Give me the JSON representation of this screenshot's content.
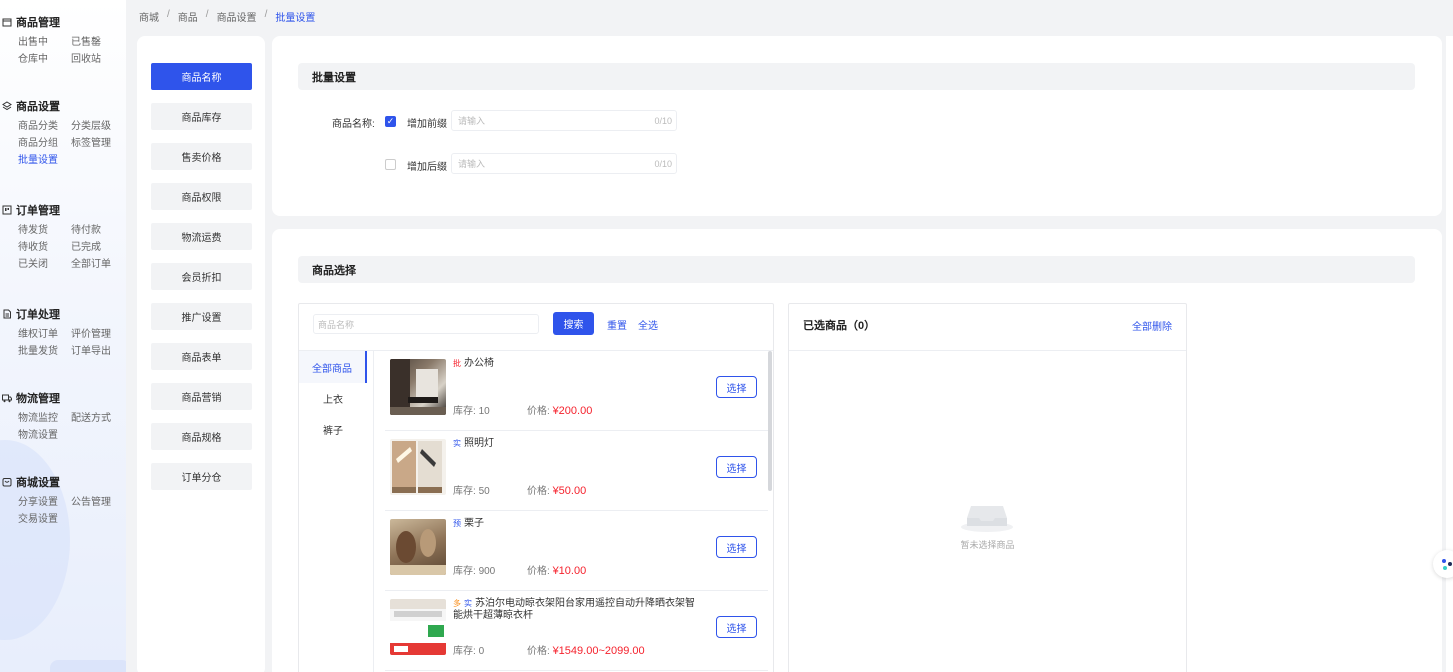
{
  "sidebar": {
    "groups": [
      {
        "title": "商品管理",
        "icon": "box-icon",
        "items": [
          "出售中",
          "已售罄",
          "仓库中",
          "回收站"
        ]
      },
      {
        "title": "商品设置",
        "icon": "layers-icon",
        "items": [
          "商品分类",
          "分类层级",
          "商品分组",
          "标签管理",
          "批量设置"
        ]
      },
      {
        "title": "订单管理",
        "icon": "order-icon",
        "items": [
          "待发货",
          "待付款",
          "待收货",
          "已完成",
          "已关闭",
          "全部订单"
        ]
      },
      {
        "title": "订单处理",
        "icon": "document-icon",
        "items": [
          "维权订单",
          "评价管理",
          "批量发货",
          "订单导出"
        ]
      },
      {
        "title": "物流管理",
        "icon": "truck-icon",
        "items": [
          "物流监控",
          "配送方式",
          "物流设置"
        ]
      },
      {
        "title": "商城设置",
        "icon": "store-icon",
        "items": [
          "分享设置",
          "公告管理",
          "交易设置"
        ]
      }
    ],
    "active_item": "批量设置"
  },
  "breadcrumb": [
    "商城",
    "商品",
    "商品设置",
    "批量设置"
  ],
  "menu": [
    "商品名称",
    "商品库存",
    "售卖价格",
    "商品权限",
    "物流运费",
    "会员折扣",
    "推广设置",
    "商品表单",
    "商品营销",
    "商品规格",
    "订单分仓"
  ],
  "batch": {
    "title": "批量设置",
    "field_label": "商品名称:",
    "prefix_label": "增加前缀",
    "suffix_label": "增加后缀",
    "prefix_checked": true,
    "suffix_checked": false,
    "placeholder": "请输入",
    "counter": "0/10"
  },
  "goods": {
    "title": "商品选择",
    "search_placeholder": "商品名称",
    "search_btn": "搜索",
    "reset": "重置",
    "select_all": "全选",
    "categories": [
      "全部商品",
      "上衣",
      "裤子"
    ],
    "stock_label": "库存:",
    "price_label": "价格:",
    "choose_label": "选择",
    "items": [
      {
        "tags": [
          "批"
        ],
        "name": "办公椅",
        "stock": "10",
        "price": "¥200.00"
      },
      {
        "tags": [
          "实"
        ],
        "name": "照明灯",
        "stock": "50",
        "price": "¥50.00"
      },
      {
        "tags": [
          "预"
        ],
        "name": "栗子",
        "stock": "900",
        "price": "¥10.00"
      },
      {
        "tags": [
          "多",
          "实"
        ],
        "name": "苏泊尔电动晾衣架阳台家用遥控自动升降晒衣架智能烘干超薄晾衣杆",
        "stock": "0",
        "price": "¥1549.00~2099.00"
      }
    ]
  },
  "selected": {
    "title": "已选商品（0）",
    "clear_all": "全部删除",
    "empty_text": "暂未选择商品"
  },
  "colors": {
    "primary": "#2f54eb",
    "price": "#f5222d",
    "bg": "#f2f3f5"
  }
}
